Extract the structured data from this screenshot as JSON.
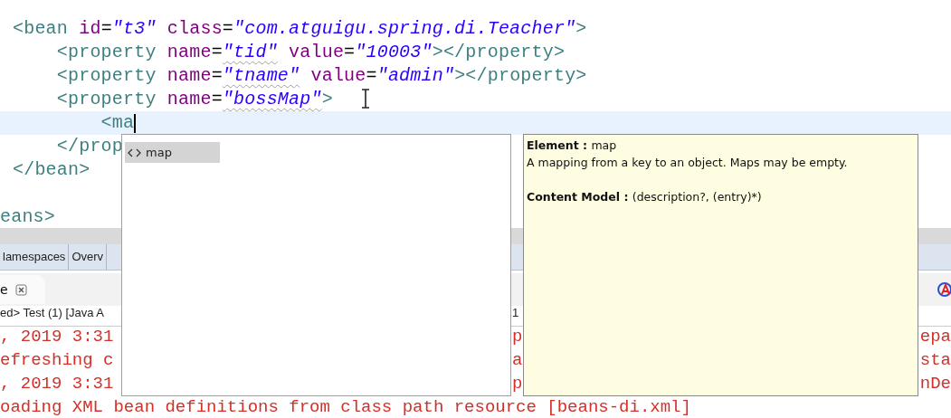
{
  "editor": {
    "lines": [
      {
        "current": false,
        "segments": [
          {
            "kind": "tag",
            "text": "<bean"
          },
          {
            "kind": "attr",
            "text": " id"
          },
          {
            "kind": "plain",
            "text": "="
          },
          {
            "kind": "value",
            "text": "\"t3\""
          },
          {
            "kind": "attr",
            "text": " class"
          },
          {
            "kind": "plain",
            "text": "="
          },
          {
            "kind": "value",
            "text": "\"com.atguigu.spring.di.Teacher\""
          },
          {
            "kind": "tag",
            "text": ">"
          }
        ]
      },
      {
        "current": false,
        "segments": [
          {
            "kind": "tag",
            "text": "    <property"
          },
          {
            "kind": "attr",
            "text": " name"
          },
          {
            "kind": "plain",
            "text": "="
          },
          {
            "kind": "value",
            "text": "\"tid\"",
            "misspelled": true
          },
          {
            "kind": "attr",
            "text": " value"
          },
          {
            "kind": "plain",
            "text": "="
          },
          {
            "kind": "value",
            "text": "\"10003\""
          },
          {
            "kind": "tag",
            "text": "></property>"
          }
        ]
      },
      {
        "current": false,
        "segments": [
          {
            "kind": "tag",
            "text": "    <property"
          },
          {
            "kind": "attr",
            "text": " name"
          },
          {
            "kind": "plain",
            "text": "="
          },
          {
            "kind": "value",
            "text": "\"tname\"",
            "misspelled": true
          },
          {
            "kind": "attr",
            "text": " value"
          },
          {
            "kind": "plain",
            "text": "="
          },
          {
            "kind": "value",
            "text": "\"admin\""
          },
          {
            "kind": "tag",
            "text": "></property>"
          }
        ]
      },
      {
        "current": false,
        "segments": [
          {
            "kind": "tag",
            "text": "    <property"
          },
          {
            "kind": "attr",
            "text": " name"
          },
          {
            "kind": "plain",
            "text": "="
          },
          {
            "kind": "value",
            "text": "\"bossMap\"",
            "misspelled": true
          },
          {
            "kind": "tag",
            "text": ">"
          }
        ]
      },
      {
        "current": true,
        "segments": [
          {
            "kind": "tag",
            "text": "        <ma"
          }
        ]
      },
      {
        "current": false,
        "segments": [
          {
            "kind": "tag",
            "text": "    </prop"
          }
        ]
      },
      {
        "current": false,
        "segments": [
          {
            "kind": "tag",
            "text": "</bean>"
          }
        ]
      },
      {
        "current": false,
        "outdent": true,
        "segments": [
          {
            "kind": "tag",
            "text": "eans>"
          }
        ]
      }
    ]
  },
  "editor_tabs": [
    {
      "label": "lamespaces",
      "selected": false
    },
    {
      "label": "Overv",
      "selected": false
    }
  ],
  "console": {
    "tab": {
      "label": "e"
    },
    "header": {
      "left": "ed> Test (1) [Java A",
      "middle": "1"
    },
    "lines": [
      {
        "left": ", 2019 3:31",
        "middle": "p",
        "right": "epa"
      },
      {
        "left": "efreshing c",
        "middle": "a",
        "right": "sta"
      },
      {
        "left": ", 2019 3:31",
        "middle": "p",
        "right": "nDe"
      },
      {
        "left": "oading XML bean definitions from class path resource [beans-di.xml]"
      }
    ]
  },
  "completion": {
    "items": [
      {
        "label": "map",
        "selected": true
      }
    ]
  },
  "tooltip": {
    "lines": [
      {
        "label": "Element :",
        "value": "map"
      },
      {
        "value": "A mapping from a key to an object. Maps may be empty."
      },
      {
        "label": "Content Model :",
        "value": "(description?, (entry)*)"
      }
    ]
  }
}
